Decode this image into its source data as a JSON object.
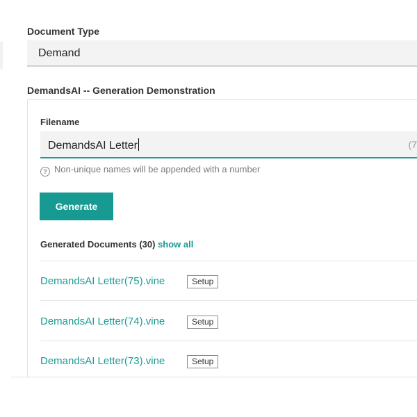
{
  "document_type": {
    "label": "Document Type",
    "value": "Demand"
  },
  "section": {
    "title": "DemandsAI -- Generation Demonstration"
  },
  "filename": {
    "label": "Filename",
    "value": "DemandsAI Letter",
    "char_count": "(7"
  },
  "help": {
    "icon": "question-circle-icon",
    "text": "Non-unique names will be appended with a number"
  },
  "generate_button": {
    "label": "Generate"
  },
  "generated_documents": {
    "title": "Generated Documents (30)",
    "show_all_label": "show all",
    "items": [
      {
        "name": "DemandsAI Letter(75).vine",
        "tag": "Setup"
      },
      {
        "name": "DemandsAI Letter(74).vine",
        "tag": "Setup"
      },
      {
        "name": "DemandsAI Letter(73).vine",
        "tag": "Setup"
      }
    ]
  },
  "colors": {
    "accent": "#179a92",
    "field_background": "#f3f3f3"
  }
}
